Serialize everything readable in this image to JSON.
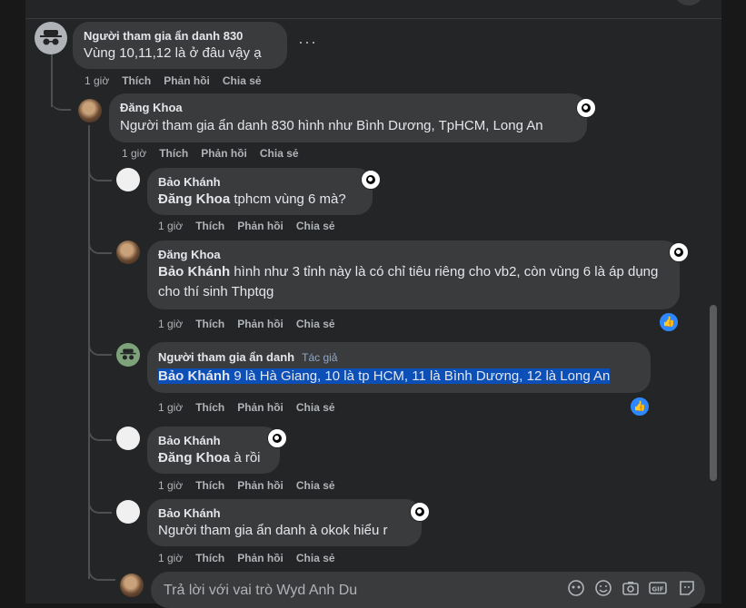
{
  "top_comment": {
    "author": "Người tham gia ẩn danh 830",
    "text": "Vùng 10,11,12 là ở đâu vậy ạ",
    "time": "1 giờ",
    "like": "Thích",
    "reply": "Phản hồi",
    "share": "Chia sẻ",
    "more": "···"
  },
  "replies": [
    {
      "author": "Đăng Khoa",
      "mention": "",
      "text": "Người tham gia ẩn danh 830 hình như Bình Dương, TpHCM, Long An",
      "time": "1 giờ",
      "like": "Thích",
      "reply": "Phản hồi",
      "share": "Chia sẻ"
    },
    {
      "author": "Bảo Khánh",
      "mention": "Đăng Khoa",
      "text": " tphcm vùng 6 mà?",
      "time": "1 giờ",
      "like": "Thích",
      "reply": "Phản hồi",
      "share": "Chia sẻ"
    },
    {
      "author": "Đăng Khoa",
      "mention": "Bảo Khánh",
      "text": " hình như 3 tỉnh này là có chỉ tiêu riêng cho vb2, còn vùng 6 là áp dụng cho thí sinh Thptqg",
      "time": "1 giờ",
      "like": "Thích",
      "reply": "Phản hồi",
      "share": "Chia sẻ"
    },
    {
      "author": "Người tham gia ẩn danh",
      "badge": "Tác giả",
      "mention": "Bảo Khánh",
      "text": " 9 là Hà Giang, 10 là tp HCM, 11 là Bình Dương, 12 là Long An",
      "time": "1 giờ",
      "like": "Thích",
      "reply": "Phản hồi",
      "share": "Chia sẻ"
    },
    {
      "author": "Bảo Khánh",
      "mention": "Đăng Khoa",
      "text": " à rồi",
      "time": "1 giờ",
      "like": "Thích",
      "reply": "Phản hồi",
      "share": "Chia sẻ"
    },
    {
      "author": "Bảo Khánh",
      "mention": "",
      "text": "Người tham gia ẩn danh à okok hiểu r",
      "time": "1 giờ",
      "like": "Thích",
      "reply": "Phản hồi",
      "share": "Chia sẻ"
    }
  ],
  "composer": {
    "placeholder": "Trả lời với vai trò Wyd Anh Du"
  },
  "colors": {
    "background": "#242526",
    "bubble": "#3a3b3c",
    "like_blue": "#2d88ff",
    "highlight": "#0b4fb7"
  },
  "icons": [
    "ellipsis-icon",
    "reaction-icon",
    "like-icon",
    "avatar-frame-icon",
    "sticker-icon",
    "emoji-icon",
    "camera-icon",
    "gif-icon",
    "attach-sticker-icon"
  ]
}
